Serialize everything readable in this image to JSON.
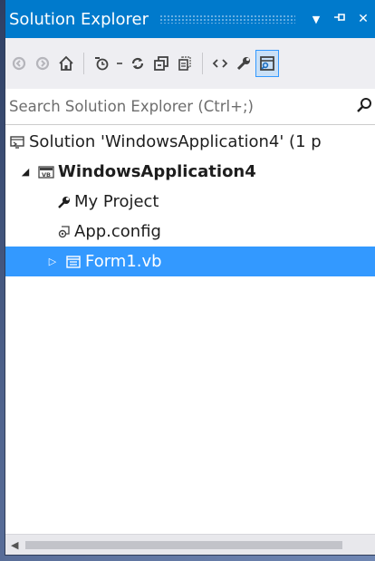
{
  "panel": {
    "title": "Solution Explorer",
    "pin_glyph": "⊣",
    "close_glyph": "✕",
    "menu_glyph": "▼"
  },
  "toolbar": {
    "items": [
      "back-icon",
      "forward-icon",
      "home-icon",
      "pending-changes-icon",
      "sync-icon",
      "collapse-all-icon",
      "show-all-files-icon",
      "view-code-icon",
      "properties-icon",
      "preview-icon"
    ]
  },
  "search": {
    "placeholder": "Search Solution Explorer (Ctrl+;)"
  },
  "tree": {
    "solution": "Solution 'WindowsApplication4' (1 p",
    "project": "WindowsApplication4",
    "my_project": "My Project",
    "app_config": "App.config",
    "form1": "Form1.vb",
    "expanded_glyph": "◢",
    "collapsed_glyph": "▷"
  },
  "colors": {
    "accent": "#007acc",
    "selection": "#3399ff"
  }
}
